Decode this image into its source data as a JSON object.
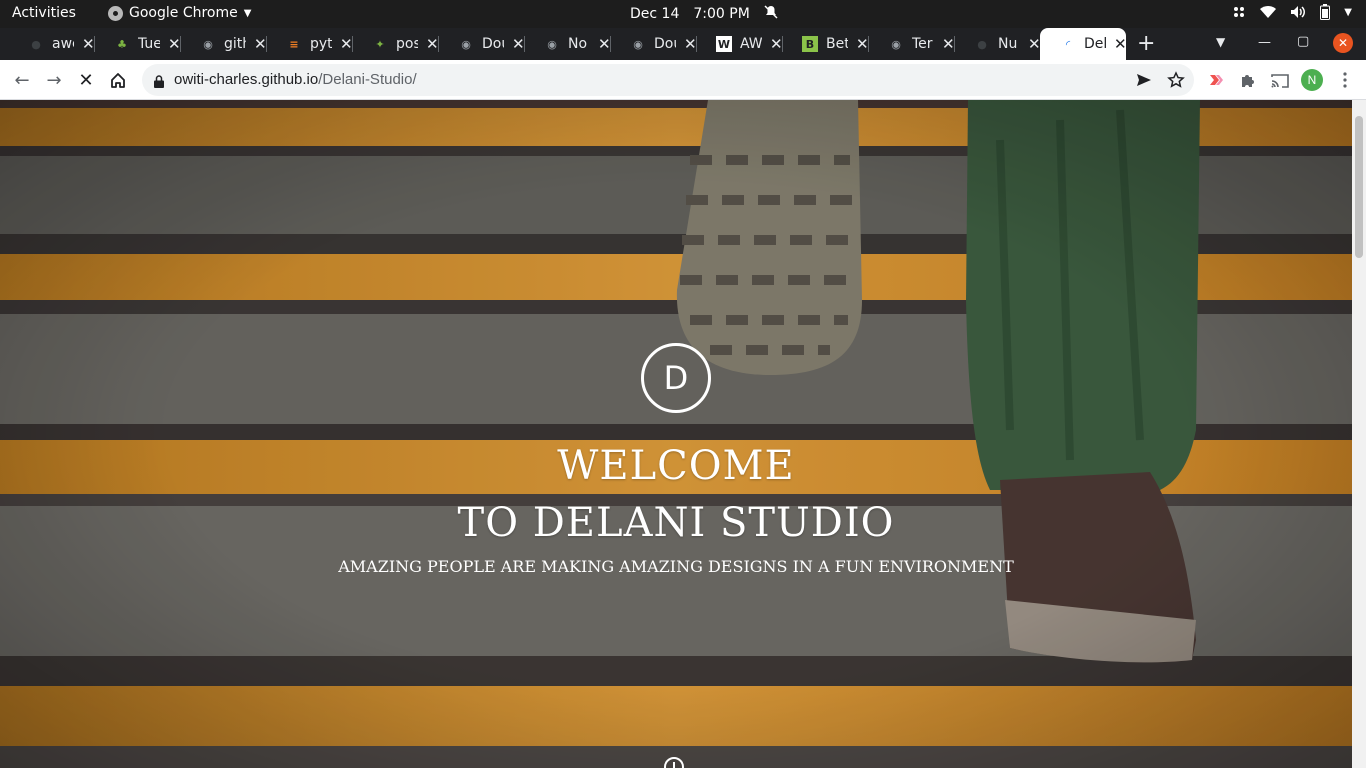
{
  "system_bar": {
    "activities": "Activities",
    "app_name": "Google Chrome",
    "date": "Dec 14",
    "time": "7:00 PM"
  },
  "tabs": [
    {
      "title": "awe",
      "icon": "github-icon"
    },
    {
      "title": "Tue",
      "icon": "palm-tree-icon"
    },
    {
      "title": "gith",
      "icon": "globe-icon"
    },
    {
      "title": "pyth",
      "icon": "stackoverflow-icon"
    },
    {
      "title": "pos",
      "icon": "spark-icon"
    },
    {
      "title": "Dou",
      "icon": "globe-icon"
    },
    {
      "title": "No",
      "icon": "globe-icon"
    },
    {
      "title": "Dou",
      "icon": "globe-icon"
    },
    {
      "title": "AW",
      "icon": "w-logo-icon"
    },
    {
      "title": "Bet",
      "icon": "bootstrap-icon"
    },
    {
      "title": "Ter",
      "icon": "globe-icon"
    },
    {
      "title": "Nu",
      "icon": "github-icon"
    },
    {
      "title": "Del",
      "icon": "loading-spinner-icon",
      "active": true
    }
  ],
  "address_bar": {
    "host": "owiti-charles.github.io",
    "path": "/Delani-Studio/"
  },
  "profile_initial": "N",
  "hero": {
    "logo_letter": "D",
    "headline_line1": "WELCOME",
    "headline_line2": "TO DELANI STUDIO",
    "tagline": "AMAZING PEOPLE ARE MAKING AMAZING DESIGNS IN A FUN ENVIRONMENT"
  }
}
